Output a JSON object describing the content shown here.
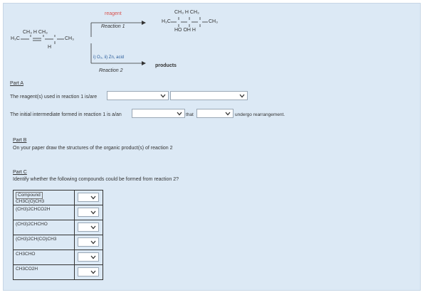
{
  "scheme": {
    "reagent_label": "reagent",
    "reaction1_label": "Reaction 1",
    "reaction2_conditions": "i) O₃, ii) Zn, acid",
    "reaction2_label": "Reaction 2",
    "products_label": "products",
    "reactant_top": "CH₃ H  CH₃",
    "reactant_left": "H₃C",
    "reactant_right": "CH₃",
    "reactant_h": "H",
    "product_top": "CH₃ H  CH₃",
    "product_left": "H₃C",
    "product_right": "CH₃",
    "product_bottom": "HO    OH H"
  },
  "partA": {
    "heading": "Part A",
    "q1": "The reagent(s) used in reaction 1 is/are",
    "q2_pre": "The initial intermediate formed in reaction 1 is a/an",
    "q2_mid": "that",
    "q2_post": "undergo rearrangement."
  },
  "partB": {
    "heading": "Part B",
    "text": "On your paper draw the structures of the organic product(s) of reaction 2"
  },
  "partC": {
    "heading": "Part C",
    "text": "Identify whether the following compounds could be formed from reaction 2?",
    "header": "Compound",
    "rows": [
      {
        "compound": "CH3C(O)CH3"
      },
      {
        "compound": "(CH3)2CHCO2H"
      },
      {
        "compound": "(CH3)2CHCHO"
      },
      {
        "compound": "(CH3)2CH(CO)CH3"
      },
      {
        "compound": "CH3CHO"
      },
      {
        "compound": "CH3CO2H"
      }
    ]
  },
  "colors": {
    "reagent_red": "#d9534f",
    "panel_bg": "#dce9f5"
  }
}
